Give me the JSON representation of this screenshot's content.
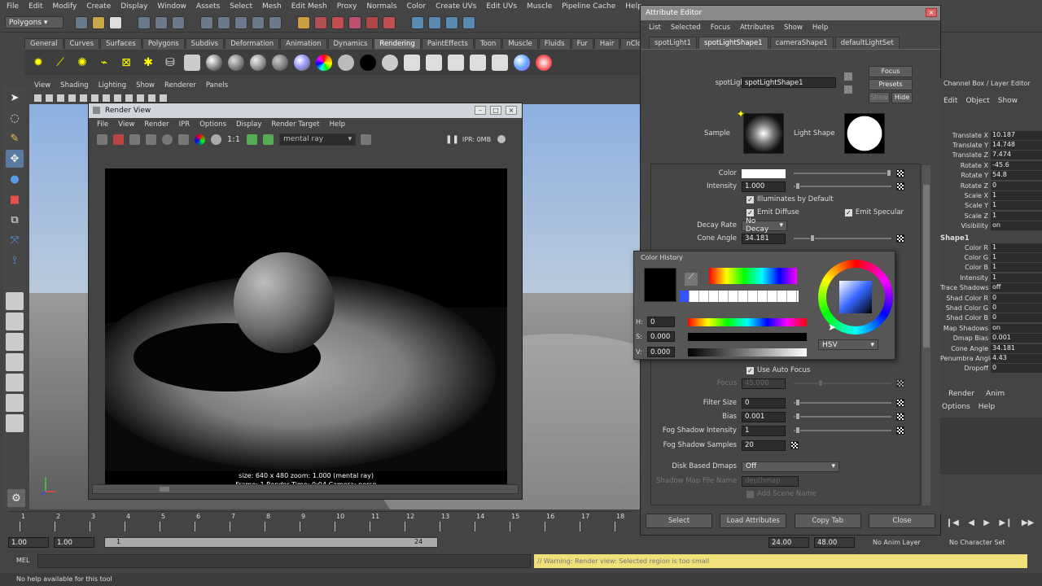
{
  "menubar": {
    "items": [
      "File",
      "Edit",
      "Modify",
      "Create",
      "Display",
      "Window",
      "Assets",
      "Select",
      "Mesh",
      "Edit Mesh",
      "Proxy",
      "Normals",
      "Color",
      "Create UVs",
      "Edit UVs",
      "Muscle",
      "Pipeline Cache",
      "Help"
    ]
  },
  "statusline": {
    "menuset": "Polygons"
  },
  "shelf": {
    "tabs": [
      "General",
      "Curves",
      "Surfaces",
      "Polygons",
      "Subdivs",
      "Deformation",
      "Animation",
      "Dynamics",
      "Rendering",
      "PaintEffects",
      "Toon",
      "Muscle",
      "Fluids",
      "Fur",
      "Hair",
      "nCloth"
    ],
    "active": "Rendering"
  },
  "panel": {
    "menu": [
      "View",
      "Shading",
      "Lighting",
      "Show",
      "Renderer",
      "Panels"
    ]
  },
  "render_view": {
    "title": "Render View",
    "menu": [
      "File",
      "View",
      "Render",
      "IPR",
      "Options",
      "Display",
      "Render Target",
      "Help"
    ],
    "ratio": "1:1",
    "renderer": "mental ray",
    "ipr_status": "IPR: 0MB",
    "info_line1": "size: 640 x 480  zoom: 1.000        (mental ray)",
    "info_line2": "Frame: 1      Render Time: 0:04      Camera: persp"
  },
  "attribute_editor": {
    "title": "Attribute Editor",
    "menu": [
      "List",
      "Selected",
      "Focus",
      "Attributes",
      "Show",
      "Help"
    ],
    "tabs": [
      "spotLight1",
      "spotLightShape1",
      "cameraShape1",
      "defaultLightSet"
    ],
    "active_tab": "spotLightShape1",
    "node_label": "spotLight:",
    "node_value": "spotLightShape1",
    "focus_btn": "Focus",
    "presets_btn": "Presets",
    "show_btn": "Show",
    "hide_btn": "Hide",
    "sample_label": "Sample",
    "light_shape_label": "Light Shape",
    "color_label": "Color",
    "intensity_label": "Intensity",
    "intensity_value": "1.000",
    "illum_default": "Illuminates by Default",
    "emit_diffuse": "Emit Diffuse",
    "emit_specular": "Emit Specular",
    "decay_label": "Decay Rate",
    "decay_value": "No Decay",
    "cone_label": "Cone Angle",
    "cone_value": "34.181",
    "use_auto_focus": "Use Auto Focus",
    "focus_label": "Focus",
    "focus_value": "45.000",
    "filter_label": "Filter Size",
    "filter_value": "0",
    "bias_label": "Bias",
    "bias_value": "0.001",
    "fog_int_label": "Fog Shadow Intensity",
    "fog_int_value": "1",
    "fog_samp_label": "Fog Shadow Samples",
    "fog_samp_value": "20",
    "disk_label": "Disk Based Dmaps",
    "disk_value": "Off",
    "shadow_file_label": "Shadow Map File Name",
    "shadow_file_value": "depthmap",
    "add_scene": "Add Scene Name",
    "bottom": [
      "Select",
      "Load Attributes",
      "Copy Tab",
      "Close"
    ]
  },
  "color_history": {
    "title": "Color History",
    "h_label": "H:",
    "h_value": "0",
    "s_label": "S:",
    "s_value": "0.000",
    "v_label": "V:",
    "v_value": "0.000",
    "mode": "HSV"
  },
  "channel_box": {
    "title": "Channel Box / Layer Editor",
    "menu": [
      "Edit",
      "Object",
      "Show"
    ],
    "rows": [
      {
        "k": "Translate X",
        "v": "10.187"
      },
      {
        "k": "Translate Y",
        "v": "14.748"
      },
      {
        "k": "Translate Z",
        "v": "7.474"
      },
      {
        "k": "Rotate X",
        "v": "-45.6"
      },
      {
        "k": "Rotate Y",
        "v": "54.8"
      },
      {
        "k": "Rotate Z",
        "v": "0"
      },
      {
        "k": "Scale X",
        "v": "1"
      },
      {
        "k": "Scale Y",
        "v": "1"
      },
      {
        "k": "Scale Z",
        "v": "1"
      },
      {
        "k": "Visibility",
        "v": "on"
      }
    ],
    "shape_title": "Shape1",
    "shape_rows": [
      {
        "k": "Color R",
        "v": "1"
      },
      {
        "k": "Color G",
        "v": "1"
      },
      {
        "k": "Color B",
        "v": "1"
      },
      {
        "k": "Intensity",
        "v": "1"
      },
      {
        "k": "Trace Shadows",
        "v": "off"
      },
      {
        "k": "Shad Color R",
        "v": "0"
      },
      {
        "k": "Shad Color G",
        "v": "0"
      },
      {
        "k": "Shad Color B",
        "v": "0"
      },
      {
        "k": "Map Shadows",
        "v": "on"
      },
      {
        "k": "Dmap Bias",
        "v": "0.001"
      },
      {
        "k": "Cone Angle",
        "v": "34.181"
      },
      {
        "k": "Penumbra Angle",
        "v": "4.43"
      },
      {
        "k": "Dropoff",
        "v": "0"
      }
    ],
    "layer_tabs": [
      "Render",
      "Anim"
    ],
    "layer_menu": [
      "Options",
      "Help"
    ]
  },
  "timeline": {
    "ticks": [
      "1",
      "2",
      "3",
      "4",
      "5",
      "6",
      "7",
      "8",
      "9",
      "10",
      "11",
      "12",
      "13",
      "14",
      "15",
      "16",
      "17",
      "18"
    ]
  },
  "range": {
    "start": "1.00",
    "start2": "1.00",
    "cur": "1",
    "end": "24",
    "end2": "24.00",
    "end3": "48.00",
    "anim_layer": "No Anim Layer",
    "char_set": "No Character Set"
  },
  "cmd": {
    "label": "MEL",
    "feedback": "// Warning: Render view: Selected region is too small"
  },
  "help": {
    "text": "No help available for this tool"
  }
}
